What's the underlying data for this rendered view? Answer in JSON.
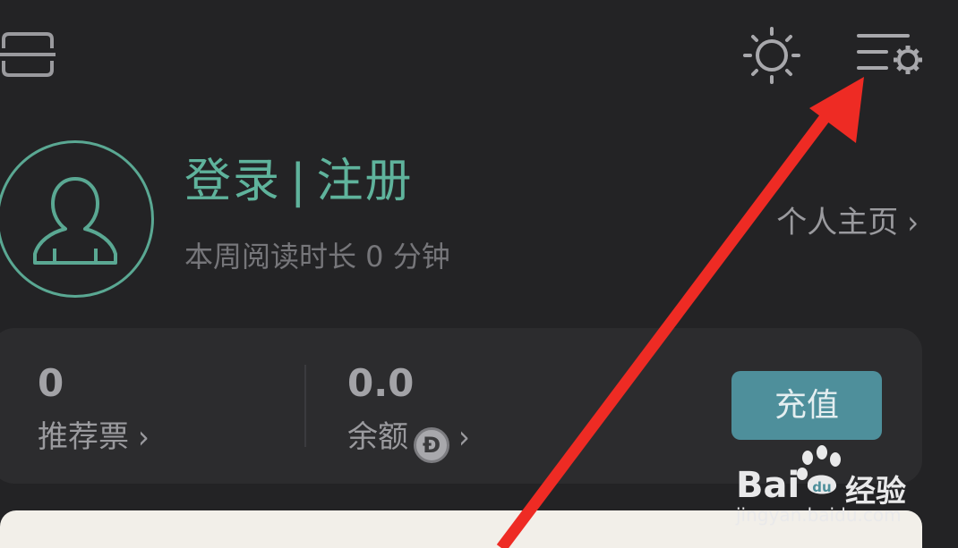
{
  "header": {
    "scan_icon": "scan-icon",
    "brightness_icon": "sun-icon",
    "settings_icon": "menu-settings-icon"
  },
  "profile": {
    "login_label": "登录",
    "separator": "|",
    "register_label": "注册",
    "reading_time": "本周阅读时长 0 分钟",
    "homepage_label": "个人主页"
  },
  "stats": {
    "tickets_value": "0",
    "tickets_label": "推荐票",
    "balance_value": "0.0",
    "balance_label": "余额",
    "coin_glyph": "Đ",
    "recharge_label": "充值"
  },
  "watermark": {
    "brand": "Bai",
    "brand2": "经验",
    "url": "jingyan.baidu.com"
  },
  "colors": {
    "background": "#232325",
    "accent": "#5fb39c",
    "card": "#2c2c2e",
    "button": "#4e8f9b",
    "arrow": "#ee2b24"
  }
}
